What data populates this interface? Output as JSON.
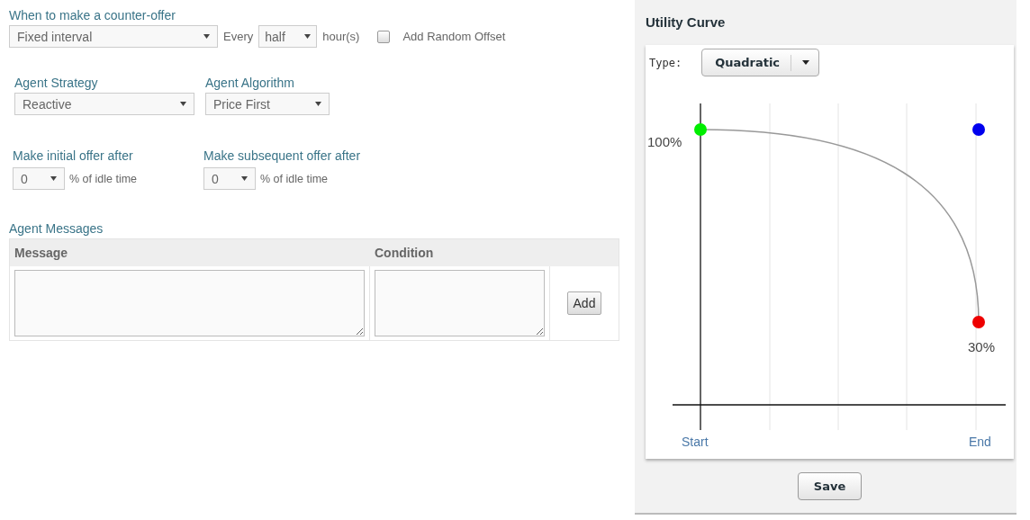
{
  "counter_offer": {
    "label": "When to make a counter-offer",
    "mode": "Fixed interval",
    "every_label": "Every",
    "interval": "half",
    "unit": "hour(s)",
    "random_offset": {
      "label": "Add Random Offset",
      "checked": false
    }
  },
  "strategy": {
    "label": "Agent Strategy",
    "value": "Reactive"
  },
  "algorithm": {
    "label": "Agent Algorithm",
    "value": "Price First"
  },
  "initial_offer": {
    "label": "Make initial offer after",
    "value": "0",
    "suffix": "% of idle time"
  },
  "subsequent_offer": {
    "label": "Make subsequent offer after",
    "value": "0",
    "suffix": "% of idle time"
  },
  "messages": {
    "title": "Agent Messages",
    "columns": [
      "Message",
      "Condition"
    ],
    "add_button": "Add"
  },
  "utility_curve": {
    "title": "Utility Curve",
    "type_label": "Type:",
    "type": "Quadratic",
    "top_label": "100%",
    "end_value_label": "30%",
    "x_start": "Start",
    "x_end": "End",
    "handles": [
      {
        "color": "#00ee00"
      },
      {
        "color": "#0000ee"
      },
      {
        "color": "#ee0000"
      }
    ],
    "save_button": "Save"
  }
}
